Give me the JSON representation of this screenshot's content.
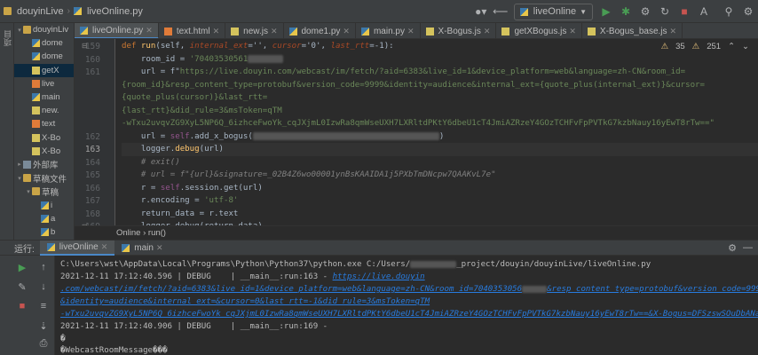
{
  "titlebar": {
    "project": "douyinLive",
    "file": "liveOnline.py",
    "run_config": "liveOnline"
  },
  "sidebar": {
    "vertical_label": "项目",
    "items": [
      {
        "label": "douyinLiv",
        "type": "folder",
        "depth": 0,
        "expanded": true
      },
      {
        "label": "dome",
        "type": "py",
        "depth": 1
      },
      {
        "label": "dome",
        "type": "py",
        "depth": 1
      },
      {
        "label": "getX",
        "type": "js",
        "depth": 1,
        "selected": true
      },
      {
        "label": "live",
        "type": "html",
        "depth": 1
      },
      {
        "label": "main",
        "type": "py",
        "depth": 1
      },
      {
        "label": "new.",
        "type": "js",
        "depth": 1
      },
      {
        "label": "text",
        "type": "html",
        "depth": 1
      },
      {
        "label": "X-Bo",
        "type": "js",
        "depth": 1
      },
      {
        "label": "X-Bo",
        "type": "js",
        "depth": 1
      },
      {
        "label": "外部库",
        "type": "lib",
        "depth": 0,
        "expanded": false
      },
      {
        "label": "草稿文件",
        "type": "folder",
        "depth": 0,
        "expanded": true
      },
      {
        "label": "草稿",
        "type": "folder",
        "depth": 1,
        "expanded": true
      },
      {
        "label": "i",
        "type": "py",
        "depth": 2
      },
      {
        "label": "a",
        "type": "py",
        "depth": 2
      },
      {
        "label": "b",
        "type": "py",
        "depth": 2
      }
    ]
  },
  "tabs": [
    {
      "label": "liveOnline.py",
      "type": "py",
      "active": true
    },
    {
      "label": "text.html",
      "type": "html"
    },
    {
      "label": "new.js",
      "type": "js"
    },
    {
      "label": "dome1.py",
      "type": "py"
    },
    {
      "label": "main.py",
      "type": "py"
    },
    {
      "label": "X-Bogus.js",
      "type": "js"
    },
    {
      "label": "getXBogus.js",
      "type": "js"
    },
    {
      "label": "X-Bogus_base.js",
      "type": "js"
    }
  ],
  "inspections": {
    "warnings": "35",
    "weak": "251"
  },
  "gutter": [
    "159",
    "160",
    "161",
    "",
    "",
    "",
    "",
    "162",
    "163",
    "164",
    "165",
    "166",
    "167",
    "168",
    "169"
  ],
  "code": {
    "l159_def": "def ",
    "l159_fn": "run",
    "l159_a": "(self, ",
    "l159_p1": "internal_ext",
    "l159_b": "='', ",
    "l159_p2": "cursor",
    "l159_c": "='0', ",
    "l159_p3": "last_rtt",
    "l159_d": "=-1):",
    "l160_a": "    room_id = ",
    "l160_s": "'70403530561",
    "l161_a": "    url = f\"",
    "l161_s": "https://live.douyin.com/webcast/im/fetch/?aid=6383&live_id=1&device_platform=web&language=zh-CN&room_id=",
    "w1": "{room_id}&resp_content_type=protobuf&version_code=9999&identity=audience&internal_ext={quote_plus(internal_ext)}&cursor=",
    "w2": "{quote_plus(cursor)}&last_rtt=",
    "w3": "{last_rtt}&did_rule=3&msToken=qTM",
    "w4": "-wTxu2uvqvZG9XyL5NP6Q_6izhceFwoYk_cqJXjmL0IzwRa8qmWseUXH7LXRltdPKtY6dbeU1cT4JmiAZRzeY4GOzTCHFvFpPVTkG7kzbNauy16yEwT8rTw==\"",
    "l162_a": "    url = ",
    "l162_self": "self",
    ".l162_b": "",
    "l162_c": ".add_x_bogus(",
    "l163": "    logger.debug(url)",
    "l164": "    # exit()",
    "l165": "    # url = f\"{url}&signature=_02B4Z6wo00001ynBsKAAIDA1j5PXbTmDNcpw7QAAKvL7e\"",
    "l166_a": "    r = ",
    "l166_self": "self",
    "l166_b": ".session.get(url)",
    "l167_a": "    r.encoding = ",
    "l167_s": "'utf-8'",
    "l168": "    return_data = r.text",
    "l169": "    logger.debug(return_data)"
  },
  "breadcrumb": "Online  ›  run()",
  "runpanel": {
    "label": "运行:",
    "tabs": [
      {
        "label": "liveOnline",
        "active": true
      },
      {
        "label": "main"
      }
    ]
  },
  "console": {
    "c1": "C:\\Users\\wst\\AppData\\Local\\Programs\\Python\\Python37\\python.exe C:/Users/",
    "c1b": "_project/douyin/douyinLive/liveOnline.py",
    "c2a": "2021-12-11 17:12:40.596 | DEBUG    | __main__:run:163 - ",
    "c2b": "https://live.douyin",
    "c3a": ".com/webcast/im/fetch/?aid=6383&live_id=1&device_platform=web&language=zh-CN&room_id=7040353056",
    "c3b": "&resp_content_type=protobuf&version_code=9999",
    "c4": "&identity=audience&internal_ext=&cursor=0&last_rtt=-1&did_rule=3&msToken=qTM",
    "c5": "-wTxu2uvqvZG9XyL5NP6Q_6izhceFwoYk_cqJXjmL0IzwRa8qmWseUXH7LXRltdPKtY6dbeU1cT4JmiAZRzeY4GOzTCHFvFpPVTkG7kzbNauy16yEwT8rTw==&X-Bogus=DFSzswSOuDbANaBISEdFp7sNhy/1",
    "c6": "2021-12-11 17:12:40.906 | DEBUG    | __main__:run:169 -",
    "c7": "�",
    "c8": "�WebcastRoomMessage���"
  }
}
